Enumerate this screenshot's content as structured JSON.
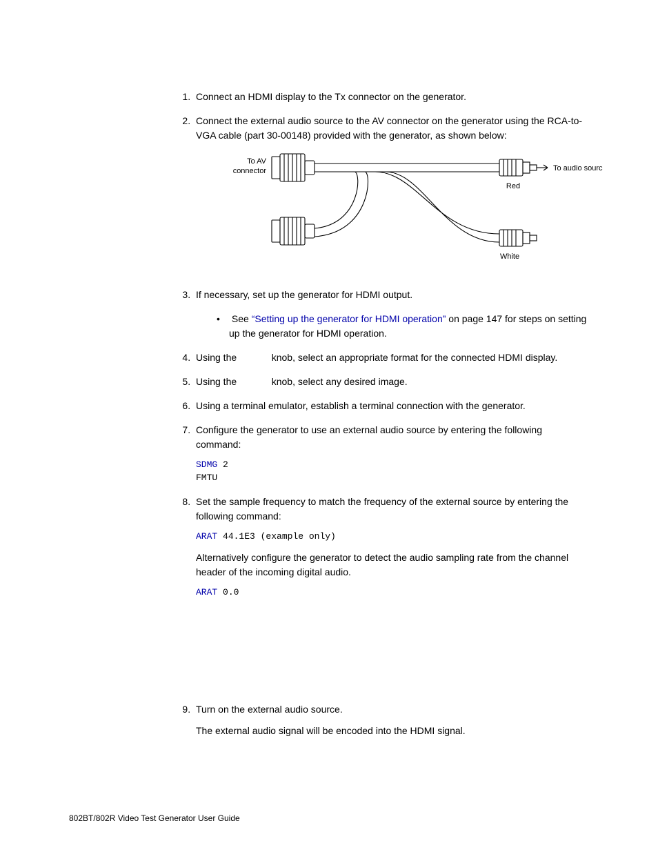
{
  "steps": {
    "s1": "Connect an HDMI display to the Tx connector on the generator.",
    "s2": "Connect the external audio source to the AV connector on the generator using the RCA-to-VGA cable (part 30-00148) provided with the generator, as shown below:",
    "s3": "If necessary, set up the generator for HDMI output.",
    "s3_sub_pre": "See ",
    "s3_link": "“Setting up the generator for HDMI operation”",
    "s3_sub_post": " on page 147 for steps on setting up the generator for HDMI operation.",
    "s4_pre": "Using the ",
    "s4_post": " knob, select an appropriate format for the connected HDMI display.",
    "s5_pre": "Using the ",
    "s5_post": " knob, select any desired image.",
    "s6": "Using a terminal emulator, establish a terminal connection with the generator.",
    "s7": "Configure the generator to use an external audio source by entering the following command:",
    "s8": "Set the sample frequency to match the frequency of the external source by entering the following command:",
    "s8_para": "Alternatively configure the generator to detect the audio sampling rate from the channel header of the incoming digital audio.",
    "s9": "Turn on the external audio source.",
    "s9_para": "The external audio signal will be encoded into the HDMI signal."
  },
  "code": {
    "c1_cmd": "SDMG",
    "c1_arg": " 2",
    "c1_line2": "FMTU",
    "c2_cmd": "ARAT",
    "c2_arg": " 44.1E3 (example only)",
    "c3_cmd": "ARAT",
    "c3_arg": " 0.0"
  },
  "diagram": {
    "left_top": "To AV",
    "left_bottom": "connector",
    "right": "To audio source",
    "red": "Red",
    "white": "White"
  },
  "footer": "802BT/802R Video Test Generator User Guide"
}
